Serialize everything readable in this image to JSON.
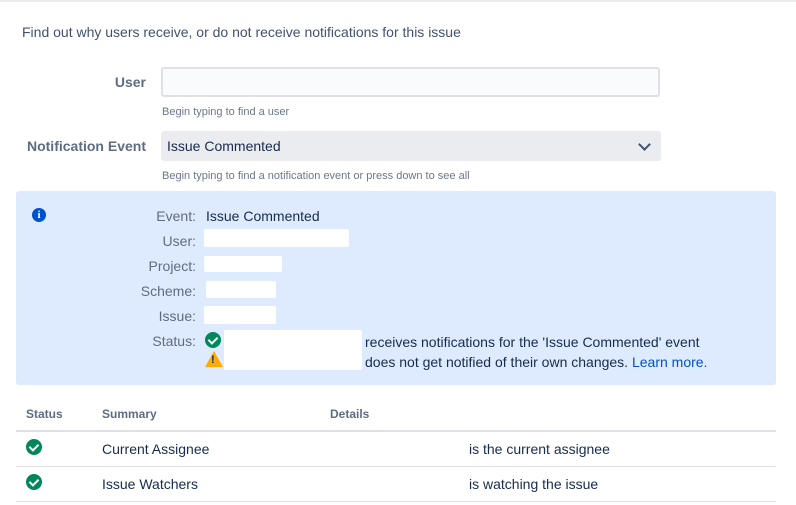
{
  "intro": "Find out why users receive, or do not receive notifications for this issue",
  "form": {
    "user_label": "User",
    "user_value": "",
    "user_hint": "Begin typing to find a user",
    "event_label": "Notification Event",
    "event_value": "Issue Commented",
    "event_hint": "Begin typing to find a notification event or press down to see all"
  },
  "info": {
    "labels": {
      "event": "Event:",
      "user": "User:",
      "project": "Project:",
      "scheme": "Scheme:",
      "issue": "Issue:",
      "status": "Status:"
    },
    "event_value": "Issue Commented",
    "status_line1": "receives notifications for the 'Issue Commented' event",
    "status_line2": "does not get notified of their own changes.",
    "learn_more": "Learn more."
  },
  "table": {
    "headers": [
      "Status",
      "Summary",
      "Details"
    ],
    "rows": [
      {
        "summary": "Current Assignee",
        "details": "is the current assignee"
      },
      {
        "summary": "Issue Watchers",
        "details": "is watching the issue"
      }
    ]
  },
  "colors": {
    "info_bg": "#deebff",
    "success": "#00875a",
    "warning": "#ffab00",
    "link": "#0052cc"
  },
  "icons": {
    "info": "info-icon",
    "success": "check-circle-icon",
    "warning": "warning-icon",
    "dropdown": "chevron-down-icon"
  }
}
